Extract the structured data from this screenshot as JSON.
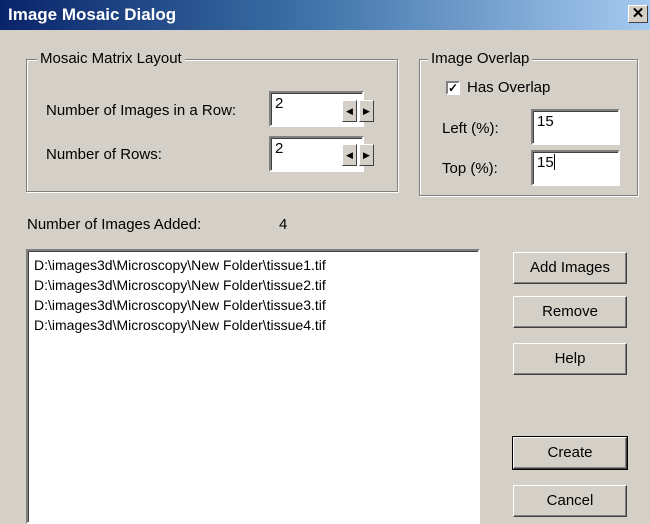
{
  "window": {
    "title": "Image Mosaic Dialog",
    "close_glyph": "✕"
  },
  "layout_group": {
    "legend": "Mosaic Matrix Layout",
    "images_per_row_label": "Number of Images in a Row:",
    "images_per_row_value": "2",
    "rows_label": "Number of Rows:",
    "rows_value": "2",
    "spin_left": "◀",
    "spin_right": "▶"
  },
  "overlap_group": {
    "legend": "Image Overlap",
    "has_overlap_label": "Has Overlap",
    "has_overlap_checked": true,
    "check_glyph": "✓",
    "left_label": "Left (%):",
    "left_value": "15",
    "top_label": "Top (%):",
    "top_value": "15"
  },
  "images_added": {
    "label": "Number of Images Added:",
    "count": "4"
  },
  "file_list": [
    "D:\\images3d\\Microscopy\\New Folder\\tissue1.tif",
    "D:\\images3d\\Microscopy\\New Folder\\tissue2.tif",
    "D:\\images3d\\Microscopy\\New Folder\\tissue3.tif",
    "D:\\images3d\\Microscopy\\New Folder\\tissue4.tif"
  ],
  "buttons": {
    "add_images": "Add Images",
    "remove": "Remove",
    "help": "Help",
    "create": "Create",
    "cancel": "Cancel"
  },
  "colors": {
    "dialog_bg": "#d4d0c8",
    "title_bar_start": "#0a246a",
    "title_bar_end": "#a6caf0"
  }
}
